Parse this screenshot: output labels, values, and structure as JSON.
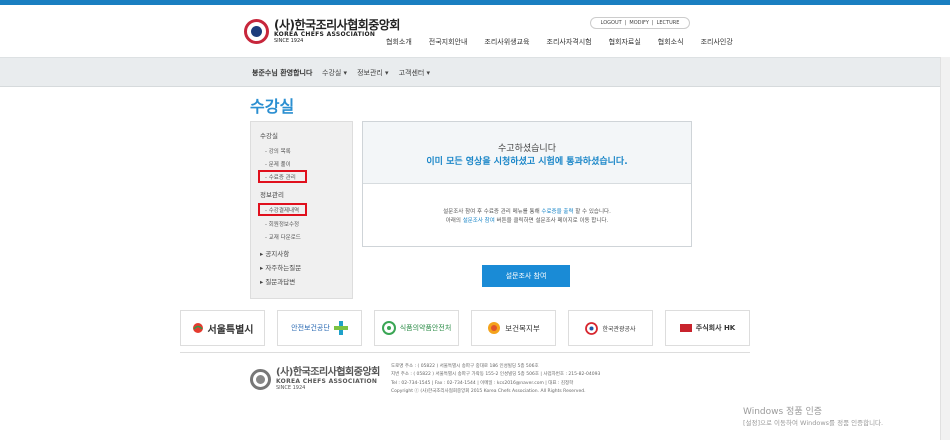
{
  "header": {
    "logo_ko": "(사)한국조리사협회중앙회",
    "logo_en": "KOREA CHEFS ASSOCIATION",
    "logo_since": "SINCE 1924",
    "util": [
      "LOGOUT",
      "|",
      "MODIFY",
      "|",
      "LECTURE"
    ],
    "gnb": [
      "협회소개",
      "전국지회안내",
      "조리사위생교육",
      "조리사자격시험",
      "협회자료실",
      "협회소식",
      "조리사인강"
    ]
  },
  "subbar": {
    "welcome": "봉준수님 환영합니다",
    "menus": [
      "수강실 ▾",
      "정보관리 ▾",
      "고객센터 ▾"
    ]
  },
  "page_title": "수강실",
  "left_menu": {
    "sec1": "수강실",
    "items1": [
      "- 강의 목록",
      "- 문제 풀이",
      "- 수료증 관리"
    ],
    "sec2": "정보관리",
    "items2": [
      "- 수강결제내역",
      "- 회원정보수정",
      "- 교재 다운로드"
    ],
    "bullets": [
      "▸ 공지사항",
      "▸ 자주하는질문",
      "▸ 질문과답변"
    ]
  },
  "notice": {
    "msg1": "수고하셨습니다",
    "msg2": "이미 모든 영상을 시청하셨고 시험에 통과하셨습니다.",
    "info1_a": "설문조사 참여 후 수료증 관리 메뉴를 통해 ",
    "info1_b": "수료증을 출력",
    "info1_c": " 할 수 있습니다.",
    "info2_a": "아래의 ",
    "info2_b": "설문조사 참여",
    "info2_c": " 버튼을 클릭하면 설문조사 페이지로 이동 합니다."
  },
  "survey_button": "설문조사 참여",
  "partners": [
    "서울특별시",
    "안전보건공단",
    "식품의약품안전처",
    "보건복지부",
    "한국관광공사",
    "주식회사 HK"
  ],
  "footer": {
    "logo_ko": "(사)한국조리사협회중앙회",
    "logo_en": "KOREA CHEFS ASSOCIATION",
    "logo_since": "SINCE 1924",
    "line1": "도로명 주소 : ( 05822 ) 서울특별시 송파구 중대로 186 인성빌딩 5층 506호",
    "line2": "지번 주소 : ( 05822 ) 서울특별시 송파구 가락동 155-2 인성빌딩 5층 506호   |   사업자번호 : 215-82-04093",
    "line3": "Tel : 02-734-1545   |   Fax : 02-734-1544   |   이메일 : kcs2016@naver.com   |   대표 : 김정학",
    "line4": "Copyright ⓒ (사)한국조리사협회중앙회 2015 Korea Chefs Association. All Rights Reserved."
  },
  "windows": {
    "line1": "Windows 정품 인증",
    "line2": "[설정]으로 이동하여 Windows를 정품 인증합니다."
  },
  "colors": {
    "accent": "#1a86c8",
    "highlight": "#e0101d"
  }
}
